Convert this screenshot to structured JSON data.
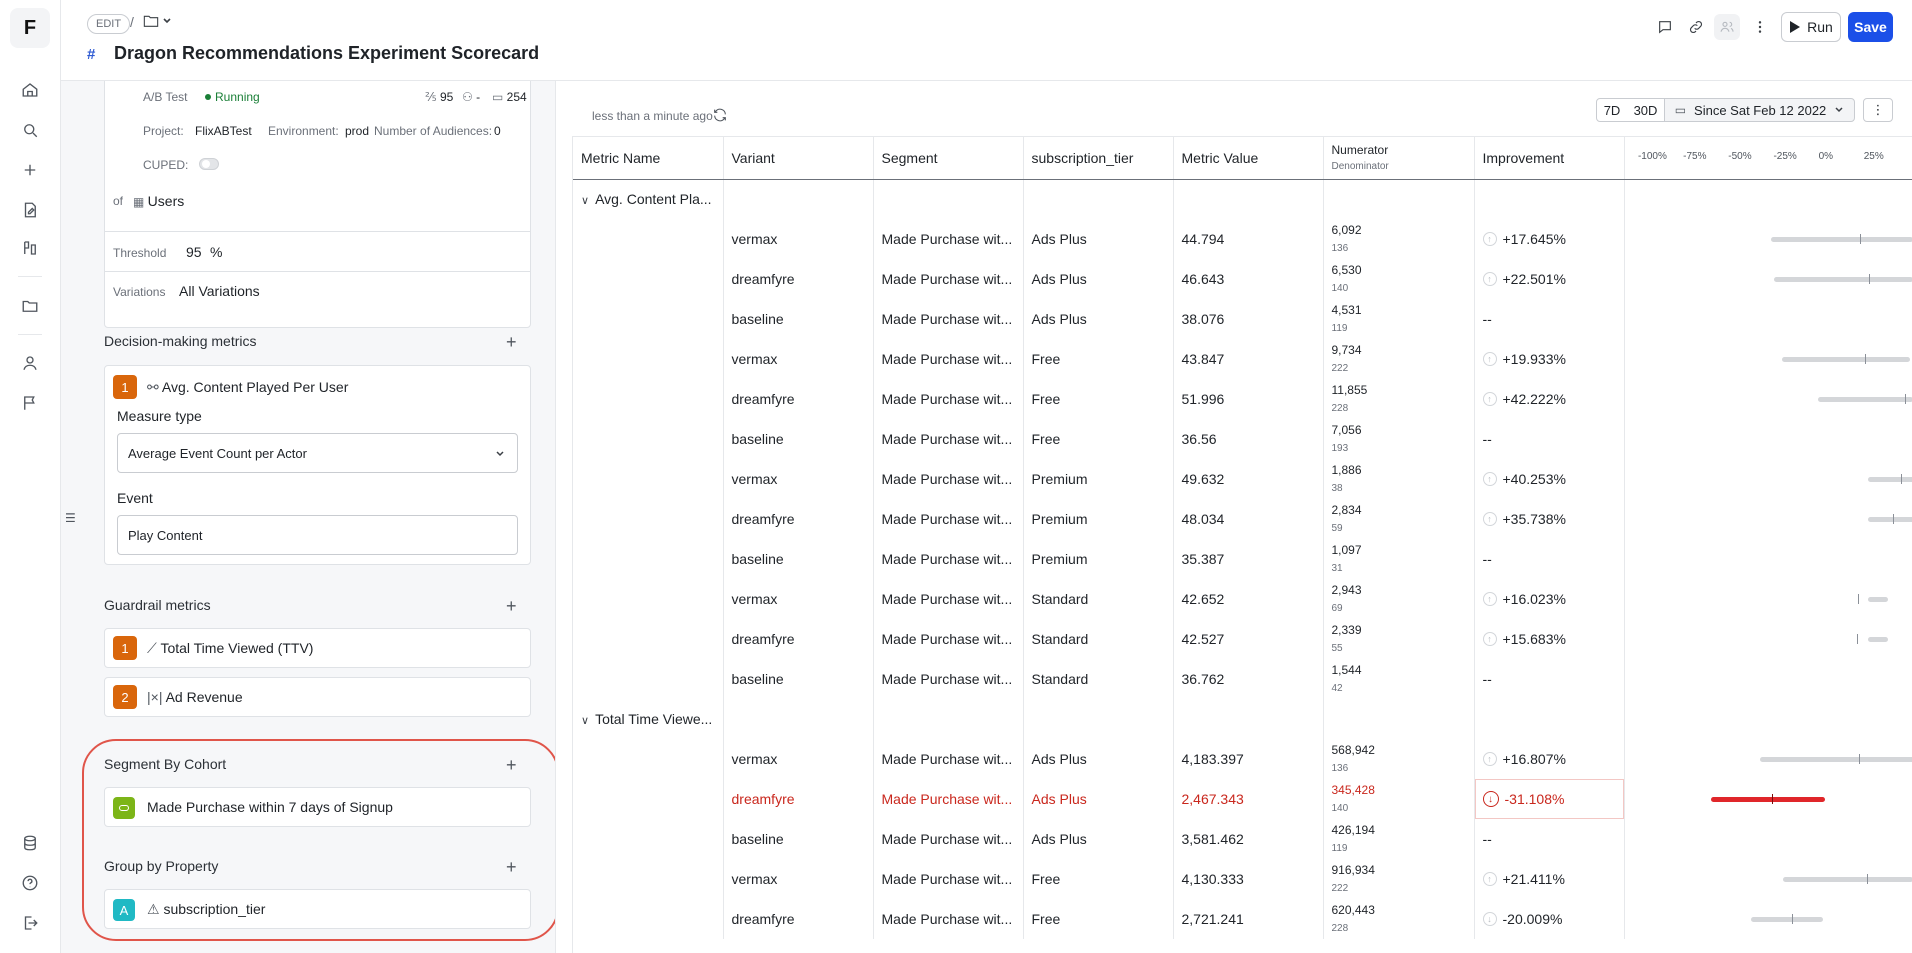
{
  "app": {
    "logo": "F"
  },
  "rail_icons": [
    "home-icon",
    "search-icon",
    "plus-icon",
    "edit-doc-icon",
    "experiment-icon",
    "folder-icon",
    "user-icon",
    "flag-icon",
    "database-icon",
    "help-icon",
    "logout-icon"
  ],
  "header": {
    "edit_label": "EDIT",
    "slash": "/",
    "title": "Dragon Recommendations Experiment Scorecard",
    "run_label": "Run",
    "save_label": "Save"
  },
  "config": {
    "test_type": "A/B Test",
    "status": "Running",
    "confidence_value": "95",
    "audience_value": "-",
    "days_value": "254",
    "project_label": "Project:",
    "project": "FlixABTest",
    "environment_label": "Environment:",
    "environment": "prod",
    "audiences_label": "Number of Audiences:",
    "audiences": "0",
    "cuped_label": "CUPED:",
    "of_label": "of",
    "of_value": "Users",
    "threshold_label": "Threshold",
    "threshold_value": "95",
    "threshold_unit": "%",
    "variations_label": "Variations",
    "variations_value": "All Variations"
  },
  "decision_metrics": {
    "title": "Decision-making metrics",
    "badge": "1",
    "metric_name": "Avg. Content Played Per User",
    "measure_label": "Measure type",
    "measure_value": "Average Event Count per Actor",
    "event_label": "Event",
    "event_value": "Play Content"
  },
  "guardrail": {
    "title": "Guardrail metrics",
    "items": [
      {
        "badge": "1",
        "name": "Total Time Viewed (TTV)"
      },
      {
        "badge": "2",
        "name": "Ad Revenue"
      }
    ]
  },
  "segment": {
    "title": "Segment By Cohort",
    "cohort": "Made Purchase within 7 days of Signup"
  },
  "group_by": {
    "title": "Group by Property",
    "badge": "A",
    "property": "subscription_tier"
  },
  "results": {
    "updated": "less than a minute ago",
    "ranges": [
      "7D",
      "30D"
    ],
    "since": "Since Sat Feb 12 2022",
    "columns": {
      "metric": "Metric Name",
      "variant": "Variant",
      "segment": "Segment",
      "tier": "subscription_tier",
      "value": "Metric Value",
      "numerator": "Numerator",
      "denominator": "Denominator",
      "improvement": "Improvement"
    },
    "axis_ticks": [
      "-100%",
      "-75%",
      "-50%",
      "-25%",
      "0%",
      "25%"
    ],
    "groups": [
      {
        "name": "Avg. Content Pla...",
        "rows": [
          {
            "variant": "vermax",
            "segment": "Made Purchase wit...",
            "tier": "Ads Plus",
            "value": "44.794",
            "num": "6,092",
            "den": "136",
            "imp": "+17.645%",
            "ci": [
              -32,
              49
            ],
            "point": 17.645
          },
          {
            "variant": "dreamfyre",
            "segment": "Made Purchase wit...",
            "tier": "Ads Plus",
            "value": "46.643",
            "num": "6,530",
            "den": "140",
            "imp": "+22.501%",
            "ci": [
              -30,
              55
            ],
            "point": 22.501
          },
          {
            "variant": "baseline",
            "segment": "Made Purchase wit...",
            "tier": "Ads Plus",
            "value": "38.076",
            "num": "4,531",
            "den": "119",
            "imp": "--"
          },
          {
            "variant": "vermax",
            "segment": "Made Purchase wit...",
            "tier": "Free",
            "value": "43.847",
            "num": "9,734",
            "den": "222",
            "imp": "+19.933%",
            "ci": [
              -26,
              45
            ],
            "point": 19.933
          },
          {
            "variant": "dreamfyre",
            "segment": "Made Purchase wit...",
            "tier": "Free",
            "value": "51.996",
            "num": "11,855",
            "den": "228",
            "imp": "+42.222%",
            "ci": [
              -6,
              80
            ],
            "point": 42.222
          },
          {
            "variant": "baseline",
            "segment": "Made Purchase wit...",
            "tier": "Free",
            "value": "36.56",
            "num": "7,056",
            "den": "193",
            "imp": "--"
          },
          {
            "variant": "vermax",
            "segment": "Made Purchase wit...",
            "tier": "Premium",
            "value": "49.632",
            "num": "1,886",
            "den": "38",
            "imp": "+40.253%",
            "ci": [
              22,
              80
            ],
            "point": 40.253
          },
          {
            "variant": "dreamfyre",
            "segment": "Made Purchase wit...",
            "tier": "Premium",
            "value": "48.034",
            "num": "2,834",
            "den": "59",
            "imp": "+35.738%",
            "ci": [
              22,
              80
            ],
            "point": 35.738
          },
          {
            "variant": "baseline",
            "segment": "Made Purchase wit...",
            "tier": "Premium",
            "value": "35.387",
            "num": "1,097",
            "den": "31",
            "imp": "--"
          },
          {
            "variant": "vermax",
            "segment": "Made Purchase wit...",
            "tier": "Standard",
            "value": "42.652",
            "num": "2,943",
            "den": "69",
            "imp": "+16.023%",
            "ci": [
              22,
              33
            ],
            "point": 16.023
          },
          {
            "variant": "dreamfyre",
            "segment": "Made Purchase wit...",
            "tier": "Standard",
            "value": "42.527",
            "num": "2,339",
            "den": "55",
            "imp": "+15.683%",
            "ci": [
              22,
              33
            ],
            "point": 15.683
          },
          {
            "variant": "baseline",
            "segment": "Made Purchase wit...",
            "tier": "Standard",
            "value": "36.762",
            "num": "1,544",
            "den": "42",
            "imp": "--"
          }
        ]
      },
      {
        "name": "Total Time Viewe...",
        "rows": [
          {
            "variant": "vermax",
            "segment": "Made Purchase wit...",
            "tier": "Ads Plus",
            "value": "4,183.397",
            "num": "568,942",
            "den": "136",
            "imp": "+16.807%",
            "ci": [
              -38,
              60
            ],
            "point": 16.807
          },
          {
            "variant": "dreamfyre",
            "segment": "Made Purchase wit...",
            "tier": "Ads Plus",
            "value": "2,467.343",
            "num": "345,428",
            "den": "140",
            "imp": "-31.108%",
            "ci": [
              -65,
              -2
            ],
            "point": -31.108,
            "negative": true
          },
          {
            "variant": "baseline",
            "segment": "Made Purchase wit...",
            "tier": "Ads Plus",
            "value": "3,581.462",
            "num": "426,194",
            "den": "119",
            "imp": "--"
          },
          {
            "variant": "vermax",
            "segment": "Made Purchase wit...",
            "tier": "Free",
            "value": "4,130.333",
            "num": "916,934",
            "den": "222",
            "imp": "+21.411%",
            "ci": [
              -25,
              60
            ],
            "point": 21.411
          },
          {
            "variant": "dreamfyre",
            "segment": "Made Purchase wit...",
            "tier": "Free",
            "value": "2,721.241",
            "num": "620,443",
            "den": "228",
            "imp": "-20.009%",
            "ci": [
              -43,
              -3
            ],
            "point": -20.009
          }
        ]
      }
    ]
  }
}
